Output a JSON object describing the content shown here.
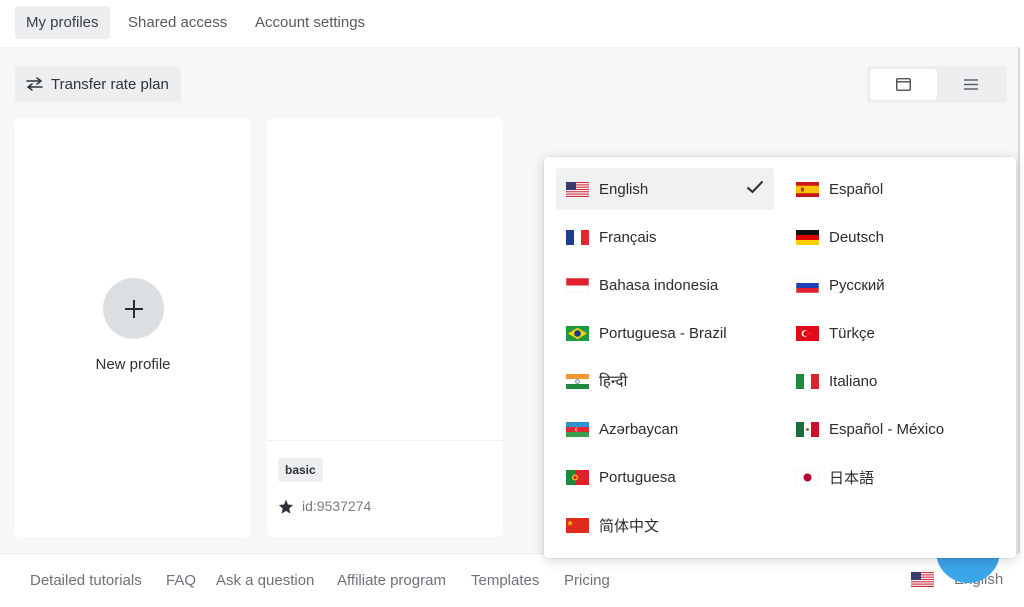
{
  "tabs": [
    {
      "label": "My profiles",
      "active": true
    },
    {
      "label": "Shared access",
      "active": false
    },
    {
      "label": "Account settings",
      "active": false
    }
  ],
  "toolbar": {
    "transfer_label": "Transfer rate plan",
    "transfer_icon": "transfer-arrows-icon",
    "view_grid_icon": "window-icon",
    "view_list_icon": "list-icon",
    "active_view": "grid"
  },
  "new_profile": {
    "label": "New profile",
    "icon": "plus-icon"
  },
  "profile": {
    "badge": "basic",
    "id": "id:9537274",
    "icon": "star-icon"
  },
  "footer": {
    "links": [
      "Detailed tutorials",
      "FAQ",
      "Ask a question",
      "Affiliate program",
      "Templates",
      "Pricing"
    ],
    "language": "English"
  },
  "languages": [
    {
      "label": "English",
      "flag": "us",
      "selected": true
    },
    {
      "label": "Español",
      "flag": "es"
    },
    {
      "label": "Français",
      "flag": "fr"
    },
    {
      "label": "Deutsch",
      "flag": "de"
    },
    {
      "label": "Bahasa indonesia",
      "flag": "id"
    },
    {
      "label": "Русский",
      "flag": "ru"
    },
    {
      "label": "Portuguesa - Brazil",
      "flag": "br"
    },
    {
      "label": "Türkçe",
      "flag": "tr"
    },
    {
      "label": "हिन्दी",
      "flag": "in"
    },
    {
      "label": "Italiano",
      "flag": "it"
    },
    {
      "label": "Azərbaycan",
      "flag": "az"
    },
    {
      "label": "Español - México",
      "flag": "mx"
    },
    {
      "label": "Portuguesa",
      "flag": "pt"
    },
    {
      "label": "日本語",
      "flag": "jp"
    },
    {
      "label": "简体中文",
      "flag": "cn"
    }
  ],
  "colors": {
    "accent": "#3aa5e8",
    "background": "#f7f7f8",
    "chip": "#eceef0"
  }
}
